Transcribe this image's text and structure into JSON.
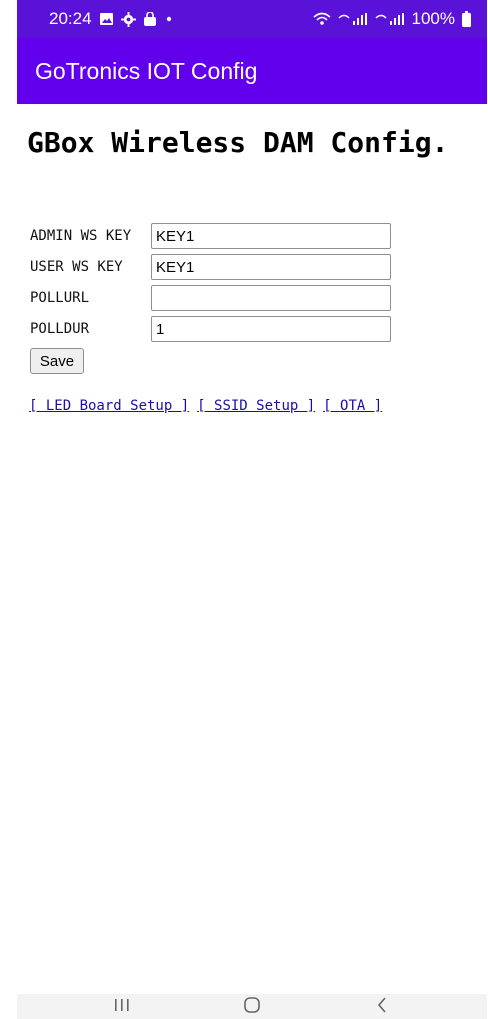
{
  "status_bar": {
    "time": "20:24",
    "battery_text": "100%",
    "icons": [
      "image-icon",
      "gear-icon",
      "bag-icon",
      "dot-icon",
      "wifi-icon",
      "signal-icon",
      "signal-icon",
      "battery-icon"
    ]
  },
  "app_bar": {
    "title": "GoTronics IOT Config"
  },
  "page": {
    "title": "GBox Wireless DAM Config.",
    "form": [
      {
        "label": "ADMIN WS KEY",
        "value": "KEY1"
      },
      {
        "label": "USER WS KEY",
        "value": "KEY1"
      },
      {
        "label": "POLLURL",
        "value": ""
      },
      {
        "label": "POLLDUR",
        "value": "1"
      }
    ],
    "save_label": "Save",
    "links": [
      "[ LED Board Setup ]",
      "[ SSID Setup ]",
      "[ OTA ]"
    ]
  },
  "nav_bar": {
    "icons": [
      "recent-apps-icon",
      "home-icon",
      "back-icon"
    ]
  },
  "colors": {
    "status_bar": "#5a12d9",
    "app_bar": "#6200ee",
    "link": "#1a0dab"
  }
}
